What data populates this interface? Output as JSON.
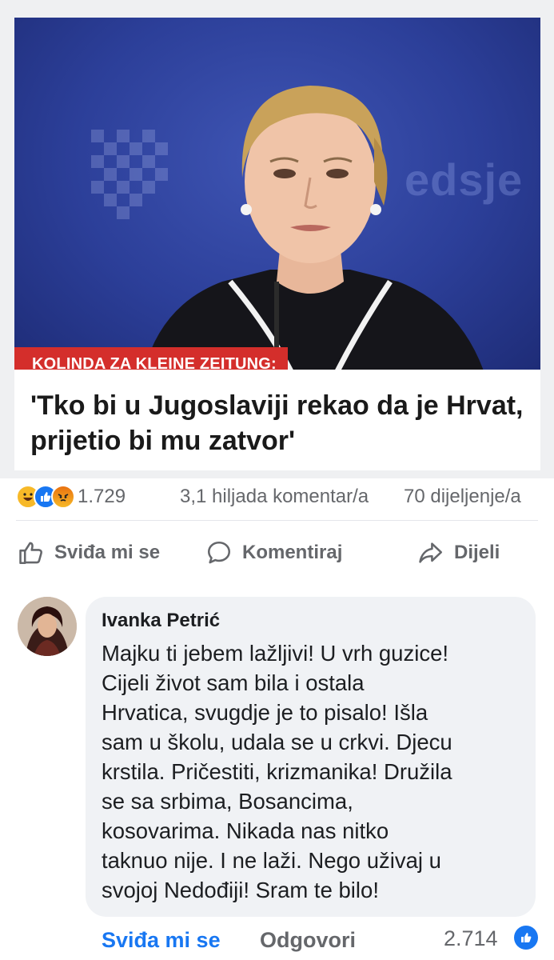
{
  "post": {
    "image_label": "KOLINDA ZA KLEINE ZEITUNG:",
    "headline": "'Tko bi u Jugoslaviji rekao da je Hrvat, prijetio bi mu zatvor'",
    "background_text": "edsje"
  },
  "stats": {
    "reaction_icons": [
      "haha-icon",
      "like-icon",
      "angry-icon"
    ],
    "reaction_count": "1.729",
    "comments": "3,1 hiljada komentar/a",
    "shares": "70 dijeljenje/a"
  },
  "actions": {
    "like_label": "Sviđa mi se",
    "comment_label": "Komentiraj",
    "share_label": "Dijeli"
  },
  "comment": {
    "author": "Ivanka Petrić",
    "text": "Majku ti jebem lažljivi! U vrh guzice!\nCijeli život sam bila i ostala\nHrvatica, svugdje je to pisalo! Išla\nsam u školu, udala se u crkvi. Djecu\nkrstila. Pričestiti, krizmanika! Družila\nse sa srbima, Bosancima,\nkosovarima.  Nikada nas nitko\ntaknuo nije. I ne laži. Nego uživaj u\nsvojoj Nedođiji! Sram te bilo!",
    "like_label": "Sviđa mi se",
    "reply_label": "Odgovori",
    "like_count": "2.714"
  },
  "colors": {
    "accent": "#1877f2",
    "label_red": "#d42e2b",
    "muted": "#65676b",
    "bubble": "#f0f2f5"
  }
}
